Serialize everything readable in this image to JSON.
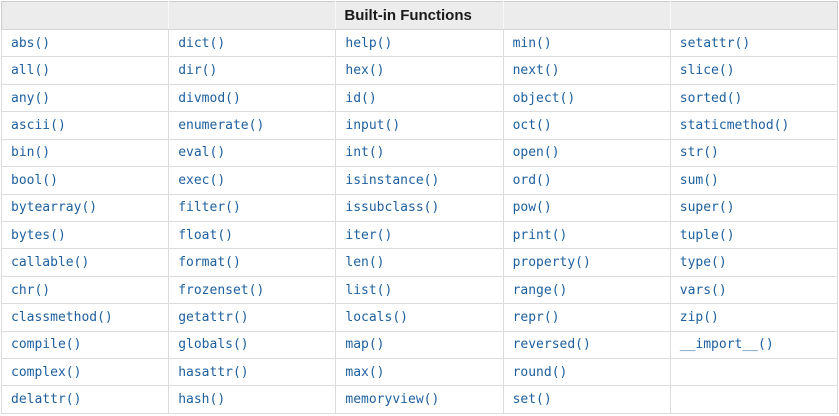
{
  "table": {
    "title": "Built-in Functions",
    "header_cells": [
      "",
      "",
      "Built-in Functions",
      "",
      ""
    ],
    "rows": [
      [
        "abs()",
        "dict()",
        "help()",
        "min()",
        "setattr()"
      ],
      [
        "all()",
        "dir()",
        "hex()",
        "next()",
        "slice()"
      ],
      [
        "any()",
        "divmod()",
        "id()",
        "object()",
        "sorted()"
      ],
      [
        "ascii()",
        "enumerate()",
        "input()",
        "oct()",
        "staticmethod()"
      ],
      [
        "bin()",
        "eval()",
        "int()",
        "open()",
        "str()"
      ],
      [
        "bool()",
        "exec()",
        "isinstance()",
        "ord()",
        "sum()"
      ],
      [
        "bytearray()",
        "filter()",
        "issubclass()",
        "pow()",
        "super()"
      ],
      [
        "bytes()",
        "float()",
        "iter()",
        "print()",
        "tuple()"
      ],
      [
        "callable()",
        "format()",
        "len()",
        "property()",
        "type()"
      ],
      [
        "chr()",
        "frozenset()",
        "list()",
        "range()",
        "vars()"
      ],
      [
        "classmethod()",
        "getattr()",
        "locals()",
        "repr()",
        "zip()"
      ],
      [
        "compile()",
        "globals()",
        "map()",
        "reversed()",
        "__import__()"
      ],
      [
        "complex()",
        "hasattr()",
        "max()",
        "round()",
        ""
      ],
      [
        "delattr()",
        "hash()",
        "memoryview()",
        "set()",
        ""
      ]
    ]
  },
  "colors": {
    "header_background": "#ececec",
    "header_text": "#1a1a1a",
    "function_link": "#1d5f9e",
    "cell_border": "#dcdcdc",
    "outer_border": "#cccccc"
  }
}
